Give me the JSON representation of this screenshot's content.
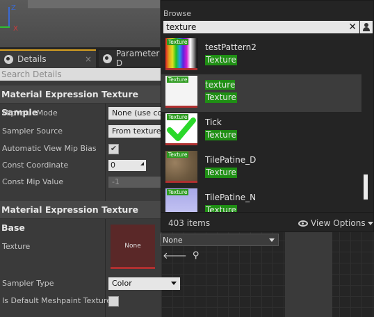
{
  "viewport": {
    "axis_z": "Z",
    "axis_x": "X"
  },
  "tabs": [
    {
      "label": "Details",
      "close": "×"
    },
    {
      "label": "Parameter D"
    }
  ],
  "search_details": {
    "placeholder": "Search Details"
  },
  "sections": {
    "texture_sample": "Material Expression Texture Sample",
    "texture_base": "Material Expression Texture Base"
  },
  "rows": {
    "mip_value_mode": {
      "label": "MipValueMode",
      "value": "None (use com"
    },
    "sampler_source": {
      "label": "Sampler Source",
      "value": "From texture a"
    },
    "auto_view_mip_bias": {
      "label": "Automatic View Mip Bias",
      "check": "✔"
    },
    "const_coordinate": {
      "label": "Const Coordinate",
      "value": "0"
    },
    "const_mip_value": {
      "label": "Const Mip Value",
      "value": "-1"
    },
    "texture": {
      "label": "Texture",
      "thumb": "None",
      "value": "None"
    },
    "sampler_type": {
      "label": "Sampler Type",
      "value": "Color"
    },
    "default_meshpaint": {
      "label": "Is Default Meshpaint Texture"
    }
  },
  "browse": {
    "title": "Browse",
    "search_value": "texture",
    "clear": "✕",
    "items": [
      {
        "name": "testPattern2",
        "type": "Texture",
        "badge": "Texture"
      },
      {
        "name": "texture",
        "type": "Texture",
        "badge": "Texture"
      },
      {
        "name": "Tick",
        "type": "Texture",
        "badge": "Texture"
      },
      {
        "name": "TilePatine_D",
        "type": "Texture",
        "badge": "Texture"
      },
      {
        "name": "TilePatine_N",
        "type": "Texture",
        "badge": "Texture"
      }
    ],
    "count": "403 items",
    "view_options": "View Options"
  },
  "colors": {
    "accent": "#d8a020",
    "highlight": "#1f8f14",
    "thumb_underline": "#b03030"
  }
}
